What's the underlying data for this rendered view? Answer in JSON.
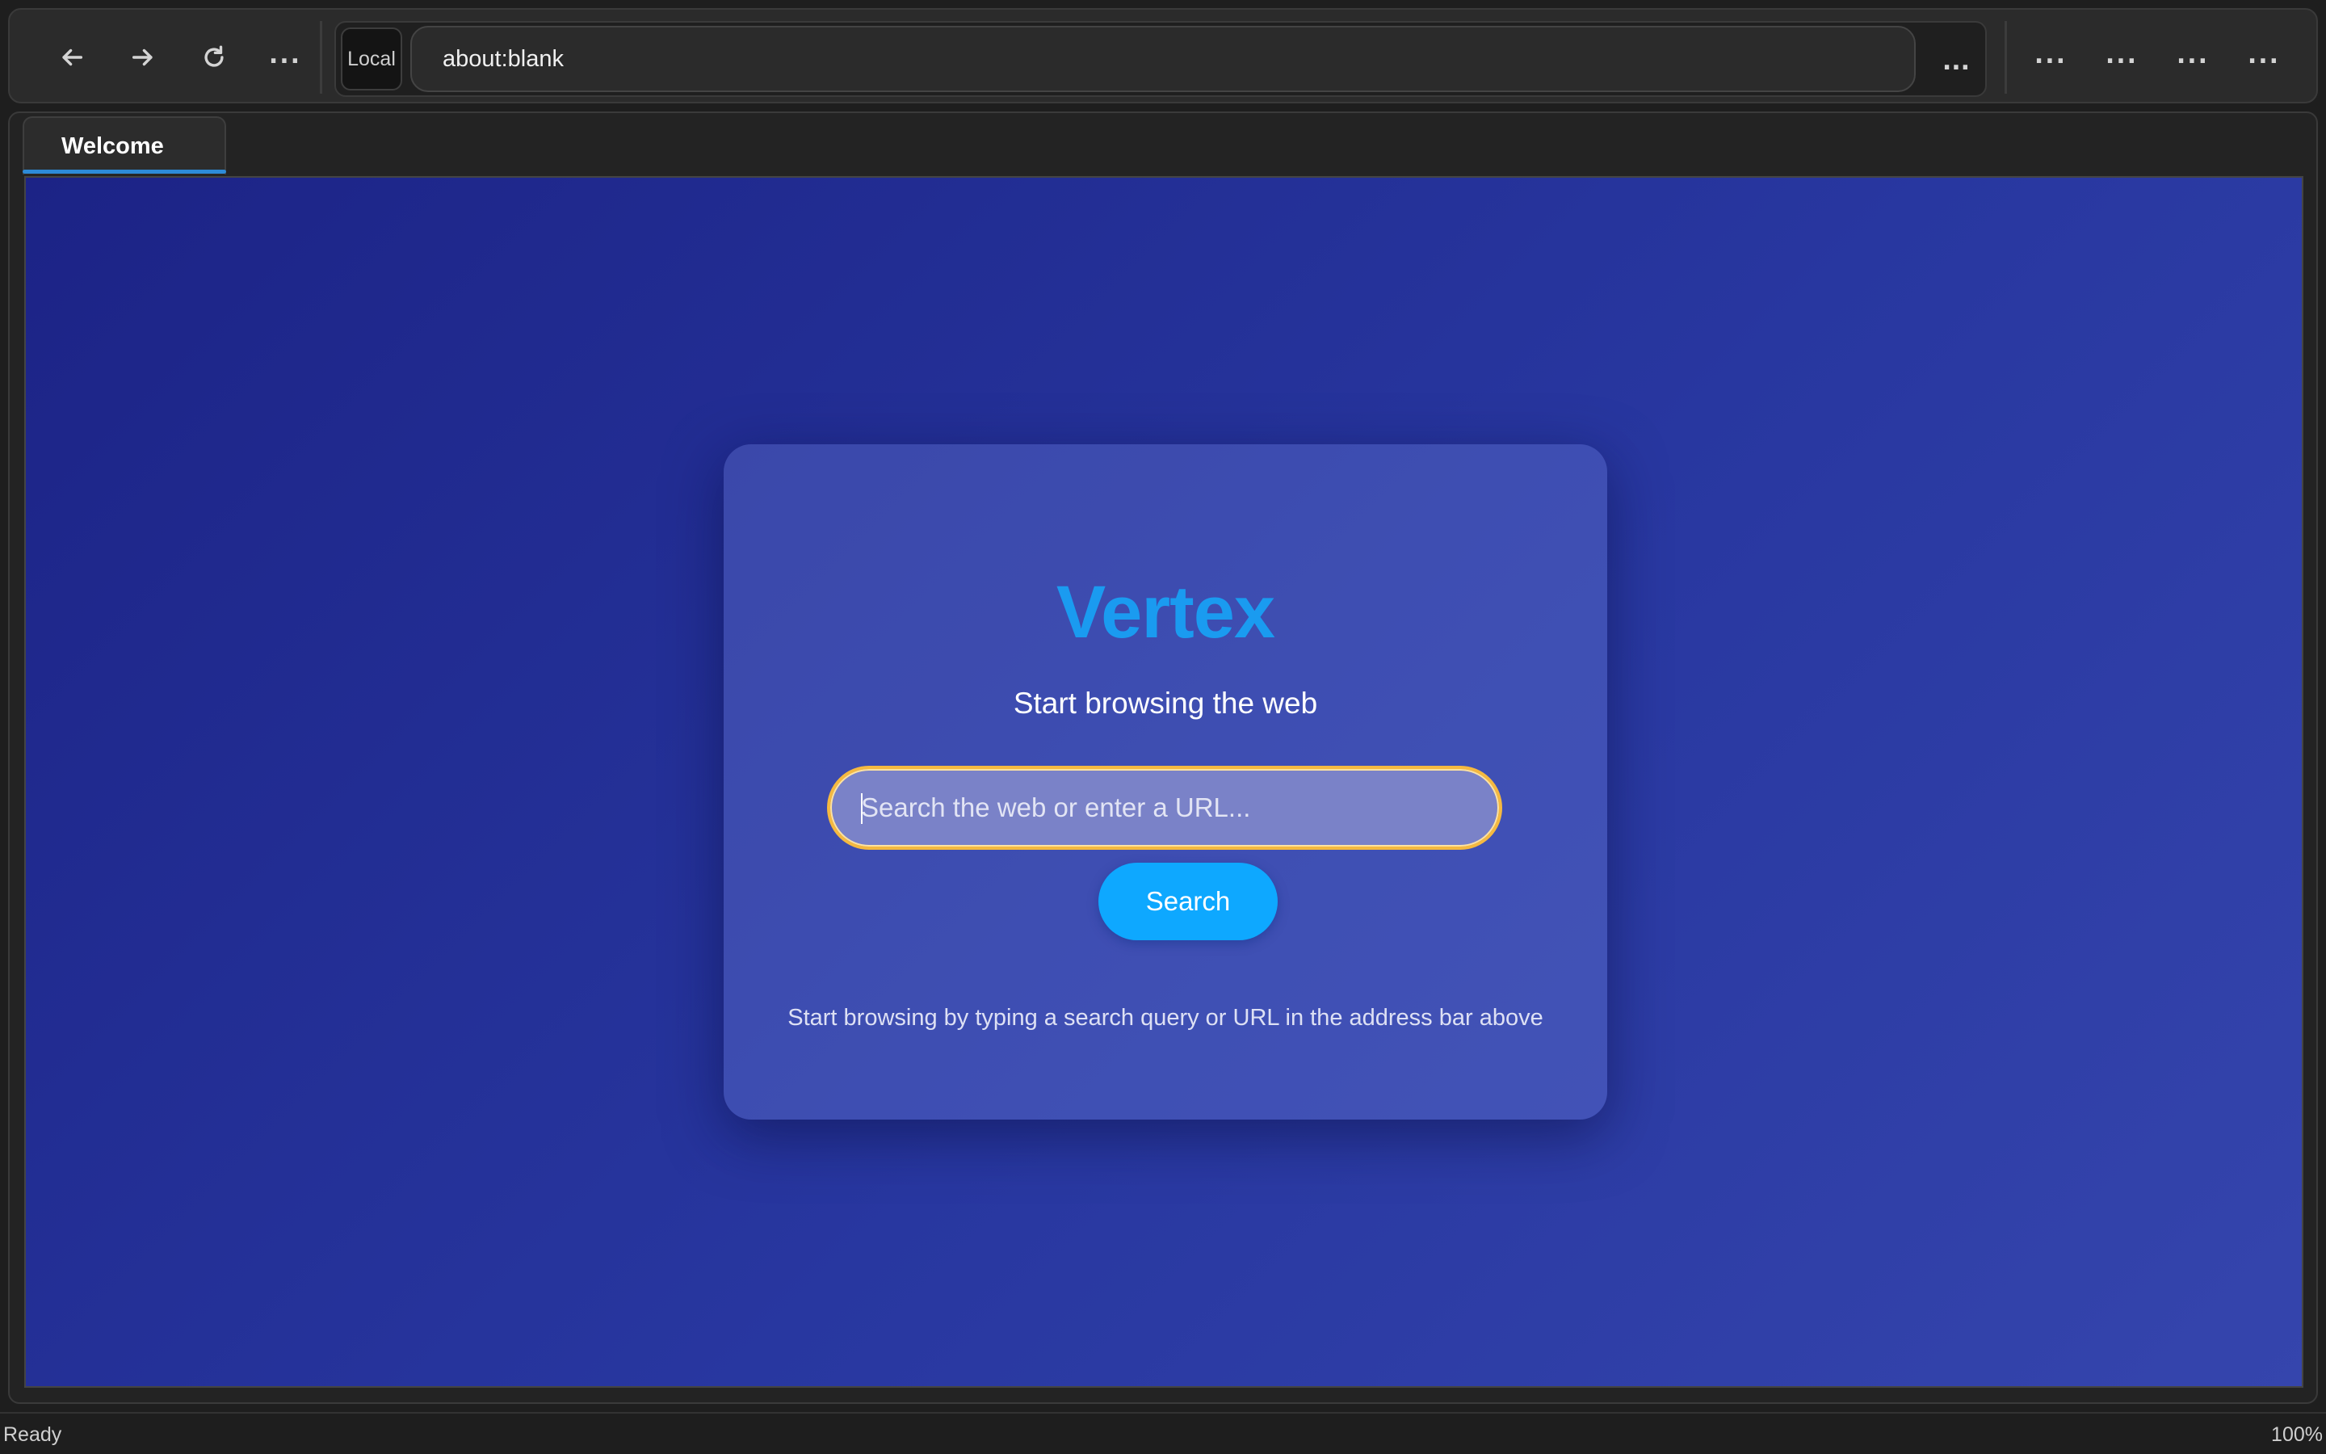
{
  "toolbar": {
    "back_icon": "arrow-left-icon",
    "forward_icon": "arrow-right-icon",
    "reload_icon": "reload-icon",
    "more_label": "...",
    "url_badge": "Local",
    "url_value": "about:blank",
    "url_more_label": "...",
    "right_menu": [
      "...",
      "...",
      "...",
      "..."
    ]
  },
  "tabs": [
    {
      "label": "Welcome",
      "active": true
    }
  ],
  "page": {
    "brand": "Vertex",
    "tagline": "Start browsing the web",
    "search_placeholder": "Search the web or enter a URL...",
    "search_button": "Search",
    "hint": "Start browsing by typing a search query or URL in the address bar above"
  },
  "status": {
    "left": "Ready",
    "right": "100%"
  },
  "colors": {
    "brand": "#1a9bf0",
    "accent_button": "#0ea8ff",
    "focus_ring": "#f5b940",
    "tab_indicator": "#2d8bd8",
    "background_gradient_start": "#1c2386",
    "background_gradient_end": "#3545ad"
  }
}
